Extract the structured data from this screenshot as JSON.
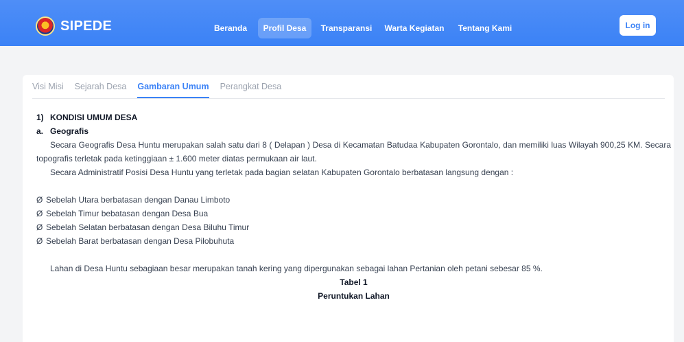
{
  "brand": {
    "name": "SIPEDE"
  },
  "nav": {
    "items": [
      {
        "label": "Beranda"
      },
      {
        "label": "Profil Desa"
      },
      {
        "label": "Transparansi"
      },
      {
        "label": "Warta Kegiatan"
      },
      {
        "label": "Tentang Kami"
      }
    ],
    "login_label": "Log in"
  },
  "tabs": [
    {
      "label": "Visi Misi"
    },
    {
      "label": "Sejarah Desa"
    },
    {
      "label": "Gambaran Umum"
    },
    {
      "label": "Perangkat Desa"
    }
  ],
  "content": {
    "section_num": "1)",
    "section_title": "KONDISI UMUM DESA",
    "sub_num": "a.",
    "sub_title": "Geografis",
    "para1": "Secara Geografis Desa Huntu merupakan salah satu dari 8 ( Delapan ) Desa di Kecamatan Batudaa Kabupaten Gorontalo, dan memiliki luas Wilayah 900,25 KM. Secara topografis terletak pada ketinggiaan ± 1.600  meter diatas permukaan air laut.",
    "para2": "Secara Administratif Posisi Desa Huntu yang terletak pada bagian selatan Kabupaten Gorontalo berbatasan langsung dengan :",
    "bullet_symbol": "Ø",
    "bullets": [
      "Sebelah Utara berbatasan dengan Danau Limboto",
      "Sebelah Timur bebatasan dengan Desa Bua",
      "Sebelah Selatan berbatasan dengan Desa Biluhu Timur",
      "Sebelah Barat berbatasan dengan Desa Pilobuhuta"
    ],
    "para3": "Lahan di Desa Huntu sebagiaan besar merupakan tanah kering yang dipergunakan sebagai lahan Pertanian oleh petani sebesar 85 %.",
    "table_label": "Tabel 1",
    "table_caption": "Peruntukan Lahan"
  },
  "colors": {
    "navbar": "#3b82f6",
    "accent": "#3b82f6",
    "background": "#f3f4f6"
  }
}
